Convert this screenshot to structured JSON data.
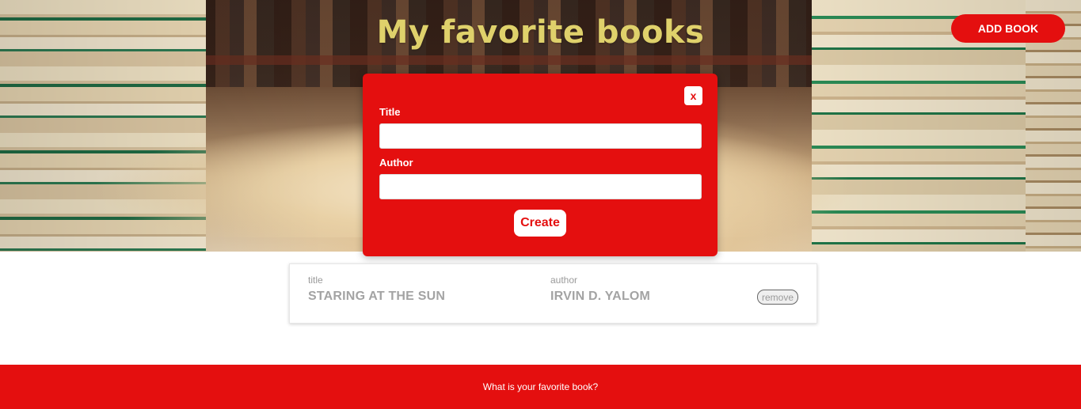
{
  "header": {
    "title": "My favorite books",
    "add_book_label": "ADD BOOK"
  },
  "modal": {
    "close_label": "x",
    "title_label": "Title",
    "title_value": "",
    "author_label": "Author",
    "author_value": "",
    "create_label": "Create"
  },
  "books": [
    {
      "title_heading": "title",
      "title": "STARING AT THE SUN",
      "author_heading": "author",
      "author": "IRVIN D. YALOM",
      "remove_label": "remove"
    }
  ],
  "footer": {
    "text": "What is your favorite book?"
  },
  "colors": {
    "accent": "#e40f0f",
    "title_color": "#dfd16b",
    "card_text": "#a3a3a3"
  },
  "background": {
    "hero_image": "library-books-background"
  }
}
